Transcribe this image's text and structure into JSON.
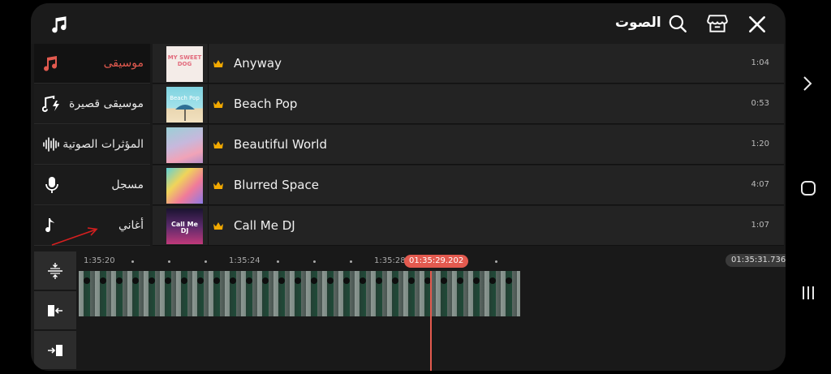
{
  "header": {
    "title": "الصوت",
    "icons": [
      "music-note-icon",
      "search-icon",
      "store-icon",
      "close-icon"
    ]
  },
  "sidebar": {
    "items": [
      {
        "label": "موسيقى",
        "icon": "music-note-icon",
        "active": true
      },
      {
        "label": "موسيقى قصيرة",
        "icon": "short-music-icon",
        "active": false
      },
      {
        "label": "المؤثرات الصوتية",
        "icon": "waveform-icon",
        "active": false
      },
      {
        "label": "مسجل",
        "icon": "microphone-icon",
        "active": false
      },
      {
        "label": "أغاني",
        "icon": "music-note-icon",
        "active": false
      }
    ]
  },
  "songs": [
    {
      "title": "Anyway",
      "duration": "1:04",
      "thumb_text": "MY SWEET DOG"
    },
    {
      "title": "Beach Pop",
      "duration": "0:53",
      "thumb_text": "Beach Pop"
    },
    {
      "title": "Beautiful World",
      "duration": "1:20",
      "thumb_text": ""
    },
    {
      "title": "Blurred Space",
      "duration": "4:07",
      "thumb_text": ""
    },
    {
      "title": "Call Me DJ",
      "duration": "1:07",
      "thumb_text": "Call Me DJ"
    }
  ],
  "timeline": {
    "ticks": [
      "1:35:20",
      "1:35:24",
      "1:35:28"
    ],
    "playhead_time": "01:35:29.202",
    "end_time": "01:35:31.736"
  },
  "colors": {
    "accent": "#e35a4f",
    "background": "#191919",
    "row": "#232323",
    "crown": "#f2a900"
  }
}
